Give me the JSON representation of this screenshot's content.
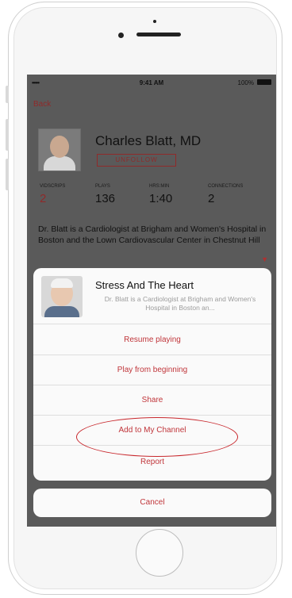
{
  "status_bar": {
    "signal": "••••• ",
    "time": "9:41 AM",
    "battery_text": "100%"
  },
  "nav": {
    "back_label": "Back"
  },
  "profile": {
    "name": "Charles Blatt, MD",
    "unfollow_label": "UNFOLLOW",
    "stats": [
      {
        "label": "VIDSCRIPS",
        "value": "2"
      },
      {
        "label": "PLAYS",
        "value": "136"
      },
      {
        "label": "HRS:MIN",
        "value": "1:40"
      },
      {
        "label": "CONNECTIONS",
        "value": "2"
      }
    ],
    "bio": "Dr. Blatt is a Cardiologist at Brigham and Women's Hospital in Boston and the Lown Cardiovascular Center in Chestnut Hill"
  },
  "action_sheet": {
    "title": "Stress And The Heart",
    "description": "Dr. Blatt is a Cardiologist at Brigham and Women's Hospital in Boston an...",
    "actions": [
      "Resume playing",
      "Play from beginning",
      "Share",
      "Add to My Channel",
      "Report"
    ],
    "cancel_label": "Cancel"
  },
  "colors": {
    "accent": "#c0353a",
    "annotation": "#c8282d",
    "overlay": "#5a5a5a"
  },
  "icons": {
    "expand": "chevron-down-icon",
    "battery": "battery-icon"
  }
}
